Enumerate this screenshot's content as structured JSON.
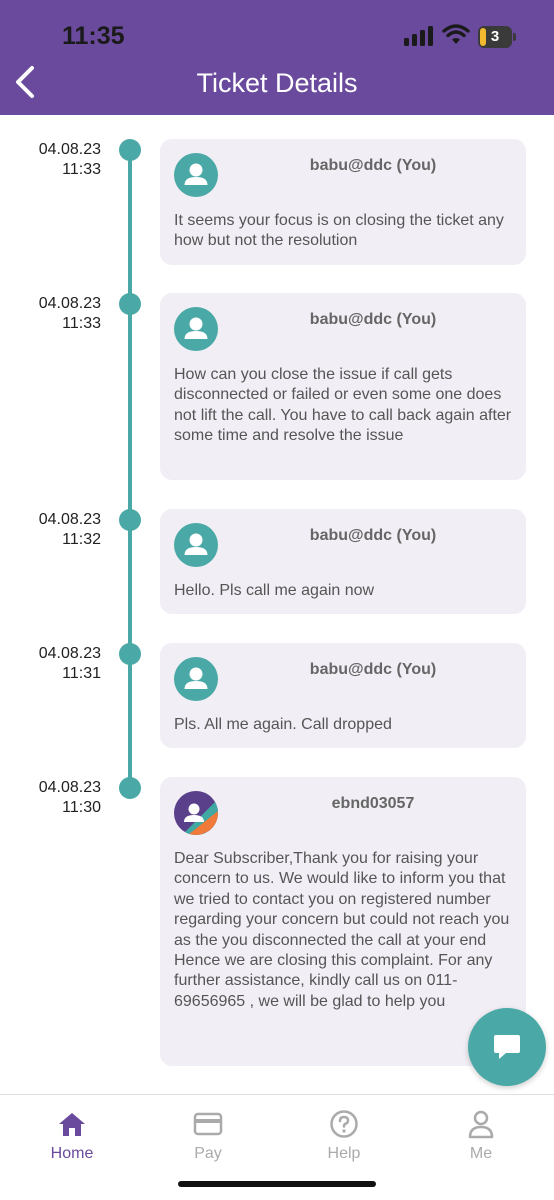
{
  "status_bar": {
    "time": "11:35",
    "battery": "3"
  },
  "header": {
    "title": "Ticket Details",
    "back_icon": "chevron-left-icon"
  },
  "colors": {
    "header": "#6a4a9c",
    "accent": "#4aa9a7",
    "card": "#f1eef5"
  },
  "entries": [
    {
      "date": "04.08.23",
      "time": "11:33",
      "sender": "babu@ddc (You)",
      "avatar_icon": "user-icon",
      "message": "It seems your focus is on closing the ticket any how but not the resolution"
    },
    {
      "date": "04.08.23",
      "time": "11:33",
      "sender": "babu@ddc (You)",
      "avatar_icon": "user-icon",
      "message": "How can you close the issue if call gets disconnected or failed or even some one does not lift the call. You have to call back again after some time and resolve the issue"
    },
    {
      "date": "04.08.23",
      "time": "11:32",
      "sender": "babu@ddc (You)",
      "avatar_icon": "user-icon",
      "message": "Hello. Pls call me again now"
    },
    {
      "date": "04.08.23",
      "time": "11:31",
      "sender": "babu@ddc (You)",
      "avatar_icon": "user-icon",
      "message": "Pls. All me again. Call dropped"
    },
    {
      "date": "04.08.23",
      "time": "11:30",
      "sender": "ebnd03057",
      "avatar_icon": "agent-avatar-icon",
      "message": "Dear Subscriber,Thank you for raising your concern to us. We would like to inform you that we tried to contact you on registered number regarding your concern but could not reach you as the you disconnected the call at your end Hence we are closing this complaint. For any further assistance, kindly call us on 011-69656965  , we will be glad to help you"
    }
  ],
  "fab": {
    "icon": "chat-icon"
  },
  "bottom_nav": [
    {
      "label": "Home",
      "icon": "home-icon",
      "active": true
    },
    {
      "label": "Pay",
      "icon": "card-icon",
      "active": false
    },
    {
      "label": "Help",
      "icon": "help-icon",
      "active": false
    },
    {
      "label": "Me",
      "icon": "person-icon",
      "active": false
    }
  ]
}
